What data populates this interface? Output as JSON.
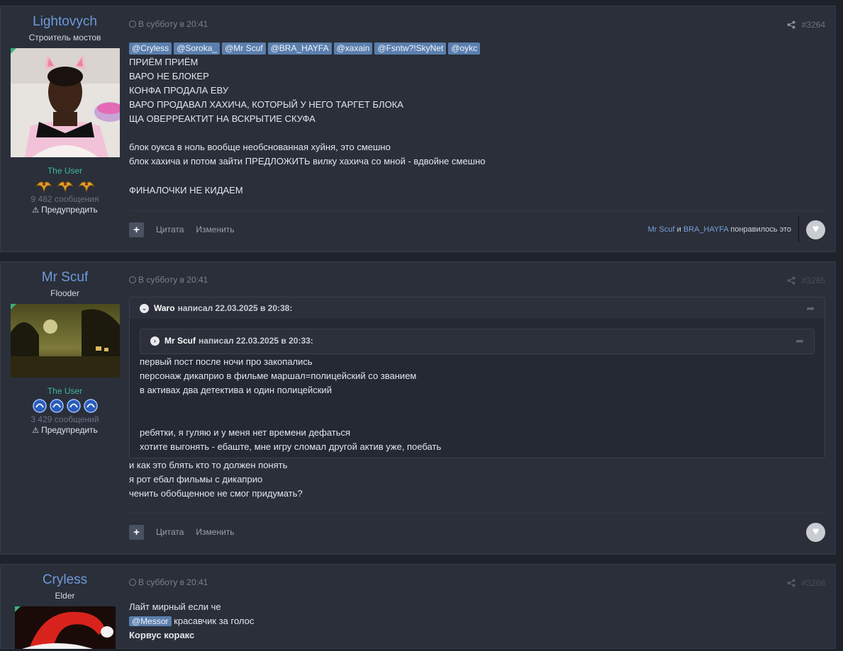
{
  "posts": [
    {
      "author": "Lightovych",
      "title": "Строитель мостов",
      "group": "The User",
      "badges": [
        "dragon-badge-icon",
        "dragon-badge-icon",
        "dragon-badge-icon"
      ],
      "post_count": "9 482 сообщения",
      "warn": "Предупредить",
      "time": "В субботу в 20:41",
      "number": "#3264",
      "mentions": [
        "@Cryless",
        "@Soroka_",
        "@Mr Scuf",
        "@BRA_HAYFA",
        "@xaxain",
        "@Fsntw?!SkyNet",
        "@oykc"
      ],
      "lines": [
        "ПРИЁМ ПРИЁМ",
        "ВАРО НЕ БЛОКЕР",
        "КОНФА ПРОДАЛА ЕВУ",
        "ВАРО ПРОДАВАЛ ХАХИЧА, КОТОРЫЙ У НЕГО ТАРГЕТ БЛОКА",
        "ЩА ОВЕРРЕАКТИТ НА ВСКРЫТИЕ СКУФА",
        "",
        "блок оукса в ноль вообще необснованная хуйня, это смешно",
        "блок хахича и потом зайти ПРЕДЛОЖИТЬ вилку хахича со мной - вдвойне смешно",
        "",
        "ФИНАЛОЧКИ НЕ КИДАЕМ"
      ],
      "quote_label": "Цитата",
      "edit_label": "Изменить",
      "likes": {
        "user1": "Mr Scuf",
        "and": "и",
        "user2": "BRA_HAYFA",
        "suffix": "понравилось это"
      }
    },
    {
      "author": "Mr Scuf",
      "title": "Flooder",
      "group": "The User",
      "badges": [
        "orb-badge-icon",
        "orb-badge-icon",
        "orb-badge-icon",
        "orb-badge-icon"
      ],
      "post_count": "3 429 сообщений",
      "warn": "Предупредить",
      "time": "В субботу в 20:41",
      "number": "#3265",
      "outer_quote": {
        "who": "Waro",
        "wrote": "написал 22.03.2025 в 20:38:"
      },
      "inner_quote": {
        "who": "Mr Scuf",
        "wrote": "написал 22.03.2025 в 20:33:"
      },
      "quote_lines": [
        "первый пост после ночи про закопались",
        "персонаж дикаприо в фильме маршал=полицейский со званием",
        "в активах два детектива и один полицейский",
        "",
        "",
        "ребятки, я гуляю и у меня нет времени дефаться",
        "хотите выгонять - ебаште, мне игру сломал другой актив уже, поебать"
      ],
      "lines": [
        "и как это блять кто то должен понять",
        "я рот ебал фильмы с дикаприо",
        "ченить обобщенное не смог придумать?"
      ],
      "quote_label": "Цитата",
      "edit_label": "Изменить"
    },
    {
      "author": "Cryless",
      "title": "Elder",
      "time": "В субботу в 20:41",
      "number": "#3266",
      "line1": "Лайт мирный если че",
      "mention": "@Messor",
      "line2_rest": "красавчик за голос",
      "line3": "Корвус коракс"
    }
  ],
  "colors": {
    "author": "#6f9ad9",
    "group": "#3fb9a1",
    "mention_bg": "#5b7fae",
    "post_bg": "#2a2f3a",
    "page_bg": "#1e222b"
  }
}
